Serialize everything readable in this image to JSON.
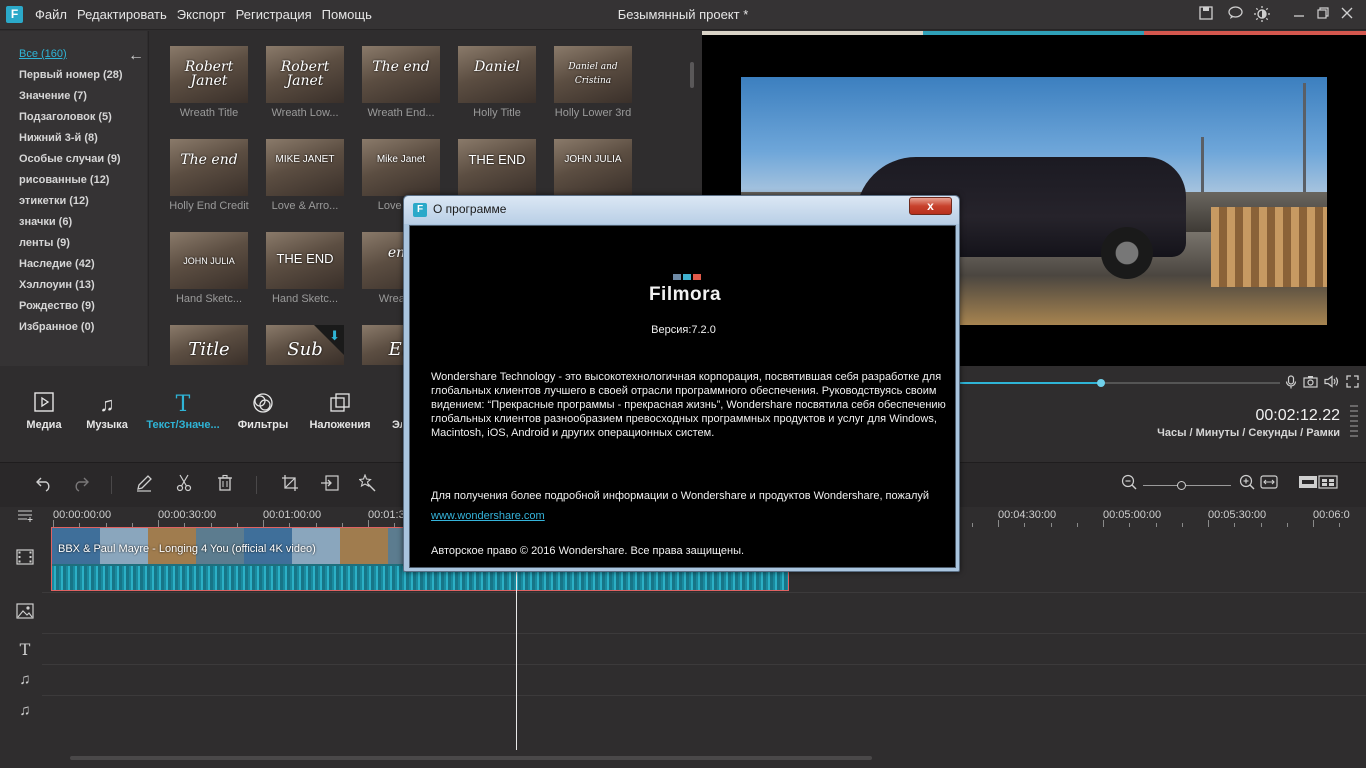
{
  "app": {
    "title": "Безымянный проект *",
    "logo_letter": "F",
    "menu": [
      "Файл",
      "Редактировать",
      "Экспорт",
      "Регистрация",
      "Помощь"
    ],
    "titlebar_icons": [
      "save-icon",
      "chat-icon",
      "brightness-icon",
      "minimize-icon",
      "restore-icon",
      "close-icon"
    ]
  },
  "categories": [
    {
      "label": "Все (160)",
      "active": true
    },
    {
      "label": "Первый номер (28)"
    },
    {
      "label": "Значение (7)"
    },
    {
      "label": "Подзаголовок (5)"
    },
    {
      "label": "Нижний 3-й (8)"
    },
    {
      "label": "Особые случаи (9)"
    },
    {
      "label": "рисованные (12)"
    },
    {
      "label": "этикетки (12)"
    },
    {
      "label": "значки (6)"
    },
    {
      "label": "ленты (9)"
    },
    {
      "label": "Наследие (42)"
    },
    {
      "label": "Хэллоуин (13)"
    },
    {
      "label": "Рождество (9)"
    },
    {
      "label": "Избранное (0)"
    }
  ],
  "thumbnails": [
    {
      "label": "Wreath Title",
      "overlay": "Robert Janet"
    },
    {
      "label": "Wreath Low...",
      "overlay": "Robert Janet"
    },
    {
      "label": "Wreath End...",
      "overlay": "The end"
    },
    {
      "label": "Holly Title",
      "overlay": "Daniel"
    },
    {
      "label": "Holly Lower 3rd",
      "overlay": "Daniel and Cristina"
    },
    {
      "label": "Holly End Credit",
      "overlay": "The end"
    },
    {
      "label": "Love & Arro...",
      "overlay": "MIKE JANET"
    },
    {
      "label": "Love & ...",
      "overlay": "Mike Janet"
    },
    {
      "label": "",
      "overlay": "THE END"
    },
    {
      "label": "",
      "overlay": "JOHN JULIA"
    },
    {
      "label": "Hand Sketc...",
      "overlay": "JOHN JULIA"
    },
    {
      "label": "Hand Sketc...",
      "overlay": "THE END"
    },
    {
      "label": "Wreath...",
      "overlay": "end"
    },
    {
      "label": "",
      "overlay": "Title"
    },
    {
      "label": "",
      "overlay": "Sub"
    },
    {
      "label": "",
      "overlay": "En"
    }
  ],
  "tabs": [
    {
      "label": "Медиа",
      "icon": "media-icon",
      "glyph": "▣"
    },
    {
      "label": "Музыка",
      "icon": "music-icon",
      "glyph": "♫"
    },
    {
      "label": "Текст/Значе...",
      "icon": "text-icon",
      "glyph": "T",
      "active": true
    },
    {
      "label": "Фильтры",
      "icon": "filters-icon",
      "glyph": "◎"
    },
    {
      "label": "Наложения",
      "icon": "overlays-icon",
      "glyph": "❐"
    },
    {
      "label": "Эл",
      "icon": "elements-icon",
      "glyph": ""
    }
  ],
  "playback": {
    "progress": 0.44,
    "timecode": "00:02:12.22",
    "units": "Часы / Минуты / Секунды / Рамки"
  },
  "timeline": {
    "ticks": [
      "00:00:00:00",
      "00:00:30:00",
      "00:01:00:00",
      "00:01:3",
      "00:04:30:00",
      "00:05:00:00",
      "00:05:30:00",
      "00:06:0"
    ],
    "clip_title": "BBX & Paul Mayre - Longing 4 You (official 4K video)"
  },
  "about": {
    "title": "О программе",
    "close_glyph": "x",
    "brand": "Filmora",
    "brand_colors": [
      "#6e8aa6",
      "#3fb1cf",
      "#e05a4a"
    ],
    "version": "Версия:7.2.0",
    "description": "Wondershare Technology - это высокотехнологичная корпорация, посвятившая себя разработке для глобальных клиентов лучшего в своей отрасли программного обеспечения. Руководствуясь своим видением: “Прекрасные программы - прекрасная жизнь”, Wondershare посвятила себя обеспечению глобальных клиентов разнообразием превосходных программных продуктов и услуг для Windows, Macintosh, iOS, Android и других операционных систем.",
    "more_info": "Для получения более подробной информации о Wondershare и продуктов Wondershare, пожалуй",
    "link": "www.wondershare.com",
    "copyright": "Авторское право © 2016 Wondershare. Все права защищены."
  },
  "colors": {
    "accent": "#2fb4d6",
    "background": "#2f2d2e"
  }
}
